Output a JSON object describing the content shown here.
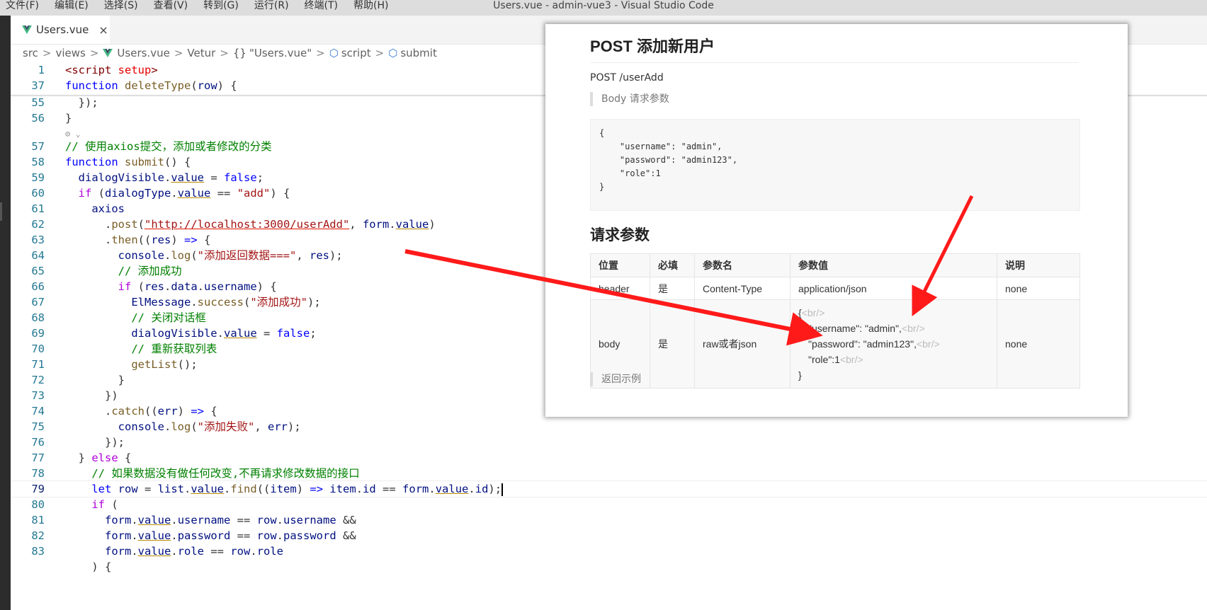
{
  "menu": [
    "文件(F)",
    "编辑(E)",
    "选择(S)",
    "查看(V)",
    "转到(G)",
    "运行(R)",
    "终端(T)",
    "帮助(H)"
  ],
  "window_title": "Users.vue - admin-vue3 - Visual Studio Code",
  "tab": {
    "label": "Users.vue",
    "close": "×"
  },
  "breadcrumb": {
    "items": [
      "src",
      "views",
      "Users.vue",
      "Vetur",
      "\"Users.vue\"",
      "script",
      "submit"
    ],
    "separator": ">"
  },
  "editor": {
    "current_line": "79",
    "line_numbers": [
      "1",
      "37",
      "55",
      "56",
      "",
      "57",
      "58",
      "59",
      "60",
      "61",
      "62",
      "63",
      "64",
      "65",
      "66",
      "67",
      "68",
      "69",
      "70",
      "71",
      "72",
      "73",
      "74",
      "75",
      "76",
      "77",
      "78",
      "79",
      "80",
      "81",
      "82",
      "83"
    ]
  },
  "doc": {
    "title": "POST 添加新用户",
    "endpoint": "POST /userAdd",
    "body_label": "Body 请求参数",
    "body_json": "{\n    \"username\": \"admin\",\n    \"password\": \"admin123\",\n    \"role\":1\n}",
    "params_title": "请求参数",
    "headers": [
      "位置",
      "必填",
      "参数名",
      "参数值",
      "说明"
    ],
    "row1": [
      "header",
      "是",
      "Content-Type",
      "application/json",
      "none"
    ],
    "row2": {
      "pos": "body",
      "required": "是",
      "name": "raw或者json",
      "desc": "none",
      "value_lines": [
        "{",
        "\"username\": \"admin\",",
        "\"password\": \"admin123\",",
        "\"role\":1",
        "}"
      ],
      "br": "<br/>"
    },
    "return_label": "返回示例"
  },
  "colors": {
    "arrow": "#ff1a1a",
    "line_number": "#237893",
    "keyword": "#0000ff",
    "comment": "#008000"
  }
}
